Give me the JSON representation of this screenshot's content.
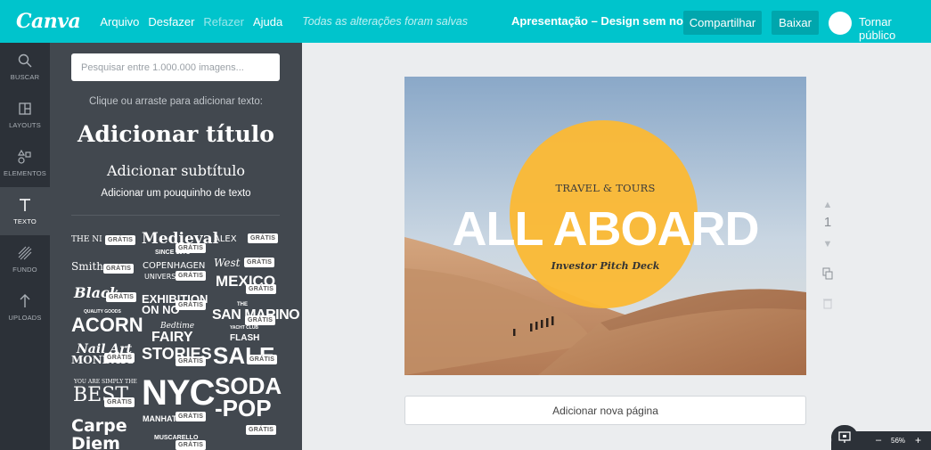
{
  "app": {
    "logo": "Canva"
  },
  "menu": [
    {
      "label": "Arquivo",
      "enabled": true
    },
    {
      "label": "Desfazer",
      "enabled": true
    },
    {
      "label": "Refazer",
      "enabled": false
    },
    {
      "label": "Ajuda",
      "enabled": true
    }
  ],
  "save_status": "Todas as alterações foram salvas",
  "document_title": "Apresentação – Design sem nome",
  "buttons": {
    "share": "Compartilhar",
    "download": "Baixar",
    "publish": "Tornar público"
  },
  "rail": [
    {
      "label": "BUSCAR",
      "icon": "search-icon"
    },
    {
      "label": "LAYOUTS",
      "icon": "layouts-icon"
    },
    {
      "label": "ELEMENTOS",
      "icon": "elements-icon"
    },
    {
      "label": "TEXTO",
      "icon": "text-icon",
      "active": true
    },
    {
      "label": "FUNDO",
      "icon": "background-icon"
    },
    {
      "label": "UPLOADS",
      "icon": "upload-icon"
    }
  ],
  "panel": {
    "search_placeholder": "Pesquisar entre 1.000.000 imagens...",
    "hint": "Clique ou arraste para adicionar texto:",
    "add_title": "Adicionar título",
    "add_subtitle": "Adicionar subtítulo",
    "add_body": "Adicionar um pouquinho de texto",
    "badge": "GRÁTIS",
    "templates": [
      {
        "text": "THE NI",
        "style": "serif"
      },
      {
        "text": "Medieval",
        "style": "blackletter"
      },
      {
        "text": "ALEX",
        "style": "sans"
      },
      {
        "text": "SINCE 1971",
        "style": "cond"
      },
      {
        "text": "Smith",
        "style": "serif"
      },
      {
        "text": "COPENHAGEN",
        "style": "sans"
      },
      {
        "text": "UNIVERSI",
        "style": "sans"
      },
      {
        "text": "West",
        "style": "script"
      },
      {
        "text": "MEXICO",
        "style": "cond"
      },
      {
        "text": "Black",
        "style": "script"
      },
      {
        "text": "EXHIBITION",
        "style": "cond"
      },
      {
        "text": "ON NO",
        "style": "cond"
      },
      {
        "text": "THE",
        "style": "cond"
      },
      {
        "text": "SAN MARINO",
        "style": "cond"
      },
      {
        "text": "QUALITY GOODS",
        "style": "cond"
      },
      {
        "text": "ACORN",
        "style": "cond"
      },
      {
        "text": "Bedtime",
        "style": "script"
      },
      {
        "text": "FAIRY",
        "style": "cond"
      },
      {
        "text": "YACHT CLUB",
        "style": "cond"
      },
      {
        "text": "FLASH",
        "style": "cond"
      },
      {
        "text": "Nail Art",
        "style": "script"
      },
      {
        "text": "MONDAYS",
        "style": "serif"
      },
      {
        "text": "STORIES",
        "style": "cond"
      },
      {
        "text": "SALE",
        "style": "cond"
      },
      {
        "text": "YOU ARE SIMPLY THE",
        "style": "serif"
      },
      {
        "text": "BEST",
        "style": "serif"
      },
      {
        "text": "NYC",
        "style": "cond"
      },
      {
        "text": "SODA",
        "style": "cond"
      },
      {
        "text": "-POP",
        "style": "cond"
      },
      {
        "text": "MANHATTAN",
        "style": "cond"
      },
      {
        "text": "Carpe",
        "style": "sans"
      },
      {
        "text": "Diem",
        "style": "sans"
      },
      {
        "text": "MUSCARELLO",
        "style": "cond"
      }
    ]
  },
  "slide": {
    "kicker": "TRAVEL & TOURS",
    "title": "ALL ABOARD",
    "subtitle": "Investor Pitch Deck",
    "circle_color": "#fbb935"
  },
  "page_number": "1",
  "add_page": "Adicionar nova página",
  "zoom": {
    "level": "56%",
    "minus": "–",
    "plus": "+"
  },
  "colors": {
    "brand": "#00c4cc",
    "sidebar": "#2c3138",
    "panel": "#42484f"
  }
}
